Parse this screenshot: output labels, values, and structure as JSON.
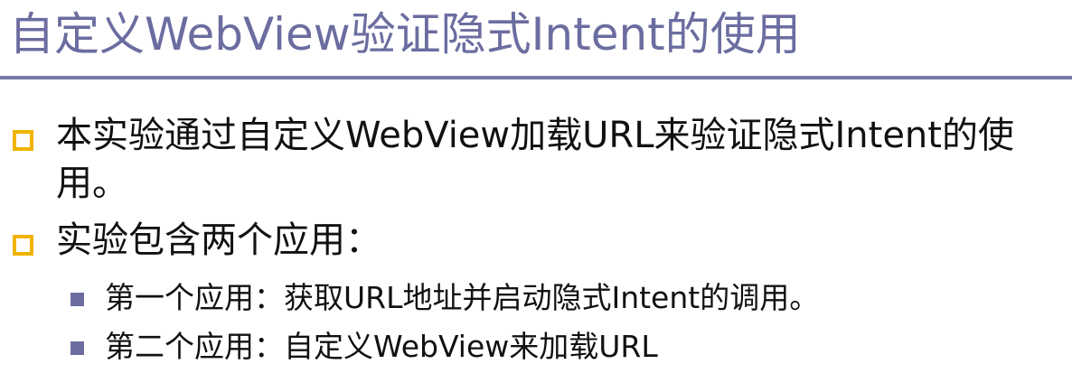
{
  "title": "自定义WebView验证隐式Intent的使用",
  "colors": {
    "title": "#6b6da0",
    "rule": "#7779a8",
    "bullet": "#f0b400",
    "sub_bullet": "#6b6da0"
  },
  "items": [
    {
      "text": "本实验通过自定义WebView加载URL来验证隐式Intent的使用。"
    },
    {
      "text": "实验包含两个应用：",
      "subitems": [
        "第一个应用：获取URL地址并启动隐式Intent的调用。",
        "第二个应用：自定义WebView来加载URL"
      ]
    }
  ]
}
